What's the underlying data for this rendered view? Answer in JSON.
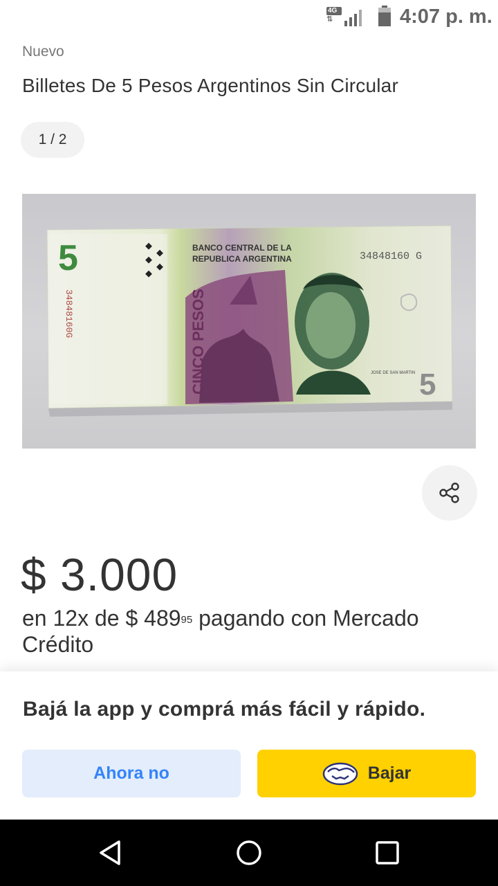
{
  "status_bar": {
    "network": "4G",
    "time": "4:07 p. m."
  },
  "product": {
    "condition": "Nuevo",
    "title": "Billetes De 5 Pesos Argentinos Sin Circular",
    "gallery_counter": "1 / 2",
    "image": {
      "bank_line1": "BANCO CENTRAL DE LA",
      "bank_line2": "REPUBLICA ARGENTINA",
      "serial": "34848160 G",
      "value": "5",
      "vertical_text": "CINCO PESOS",
      "vertical_serial": "34848160G",
      "portrait_caption": "JOSE DE SAN MARTIN"
    },
    "price": "$ 3.000",
    "installments_prefix": "en 12x de $ 489",
    "installments_cents": "95",
    "installments_suffix": " pagando con Mercado Crédito"
  },
  "app_banner": {
    "text": "Bajá la app y comprá más fácil y rápido.",
    "dismiss_label": "Ahora no",
    "download_label": "Bajar"
  },
  "icons": {
    "share": "share-icon",
    "back": "back-triangle-icon",
    "home": "home-circle-icon",
    "recents": "recents-square-icon",
    "brand": "mercadolibre-handshake-icon"
  },
  "colors": {
    "accent_blue": "#3483fa",
    "light_blue": "#e3edfb",
    "brand_yellow": "#ffd100"
  }
}
